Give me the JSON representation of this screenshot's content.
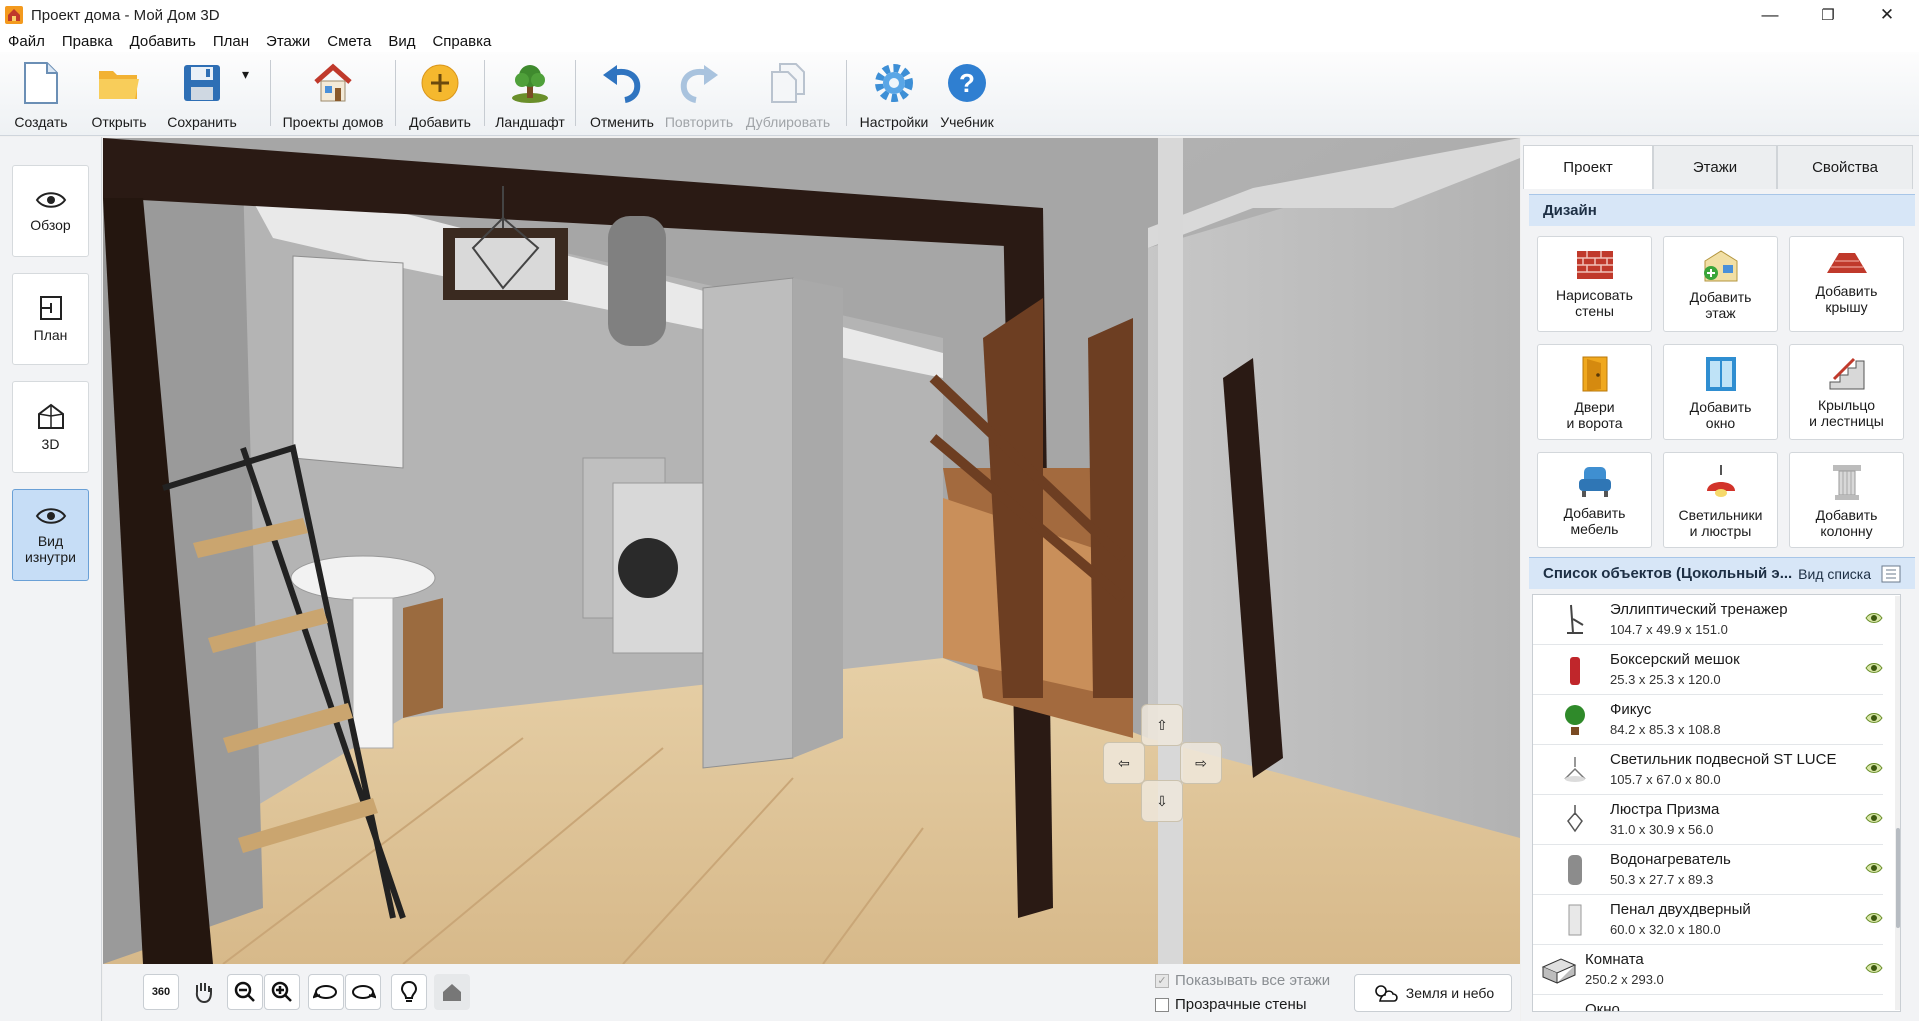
{
  "window": {
    "title": "Проект дома - Мой Дом 3D",
    "controls": [
      "—",
      "❐",
      "✕"
    ]
  },
  "menu": [
    "Файл",
    "Правка",
    "Добавить",
    "План",
    "Этажи",
    "Смета",
    "Вид",
    "Справка"
  ],
  "toolbar": {
    "create": "Создать",
    "open": "Открыть",
    "save": "Сохранить",
    "save_dropdown": "▾",
    "projects": "Проекты домов",
    "add": "Добавить",
    "landscape": "Ландшафт",
    "undo": "Отменить",
    "redo": "Повторить",
    "duplicate": "Дублировать",
    "settings": "Настройки",
    "tutorial": "Учебник"
  },
  "views": {
    "overview": "Обзор",
    "plan": "План",
    "three_d": "3D",
    "inside_line1": "Вид",
    "inside_line2": "изнутри",
    "active": "inside"
  },
  "viewport": {
    "nav_up": "⇧",
    "nav_left": "⇦",
    "nav_right": "⇨",
    "nav_down": "⇩"
  },
  "bottombar": {
    "rotate360": "360",
    "show_all_floors": "Показывать все этажи",
    "show_all_floors_checked": true,
    "transparent_walls": "Прозрачные стены",
    "transparent_walls_checked": false,
    "earth_sky": "Земля и небо"
  },
  "panel": {
    "tabs": [
      "Проект",
      "Этажи",
      "Свойства"
    ],
    "active_tab": "Проект",
    "design_header": "Дизайн",
    "design_buttons": [
      {
        "l1": "Нарисовать",
        "l2": "стены",
        "icon": "brick-wall-icon"
      },
      {
        "l1": "Добавить",
        "l2": "этаж",
        "icon": "add-floor-icon"
      },
      {
        "l1": "Добавить",
        "l2": "крышу",
        "icon": "roof-icon"
      },
      {
        "l1": "Двери",
        "l2": "и ворота",
        "icon": "door-icon"
      },
      {
        "l1": "Добавить",
        "l2": "окно",
        "icon": "window-icon"
      },
      {
        "l1": "Крыльцо",
        "l2": "и лестницы",
        "icon": "stairs-icon"
      },
      {
        "l1": "Добавить",
        "l2": "мебель",
        "icon": "armchair-icon"
      },
      {
        "l1": "Светильники",
        "l2": "и люстры",
        "icon": "lamp-icon"
      },
      {
        "l1": "Добавить",
        "l2": "колонну",
        "icon": "column-icon"
      }
    ],
    "objects_header": "Список объектов (Цокольный э...",
    "list_view": "Вид списка",
    "objects": [
      {
        "name": "Эллиптический тренажер",
        "dims": "104.7 x 49.9 x 151.0",
        "icon": "elliptical-trainer-icon"
      },
      {
        "name": "Боксерский мешок",
        "dims": "25.3 x 25.3 x 120.0",
        "icon": "punching-bag-icon"
      },
      {
        "name": "Фикус",
        "dims": "84.2 x 85.3 x 108.8",
        "icon": "plant-icon"
      },
      {
        "name": "Светильник подвесной ST LUCE",
        "dims": "105.7 x 67.0 x 80.0",
        "icon": "pendant-lamp-icon"
      },
      {
        "name": "Люстра Призма",
        "dims": "31.0 x 30.9 x 56.0",
        "icon": "chandelier-icon"
      },
      {
        "name": "Водонагреватель",
        "dims": "50.3 x 27.7 x 89.3",
        "icon": "water-heater-icon"
      },
      {
        "name": "Пенал двухдверный",
        "dims": "60.0 x 32.0 x 180.0",
        "icon": "cabinet-icon"
      },
      {
        "name": "Комната",
        "dims": "250.2 x 293.0",
        "icon": "room-icon"
      },
      {
        "name": "Окно",
        "dims": "",
        "icon": "window-icon"
      }
    ]
  },
  "colors": {
    "accent": "#4a90d9",
    "active_view": "#c6ddf6",
    "section_header": "#d7e6f7",
    "eye": "#6a8f2a"
  }
}
